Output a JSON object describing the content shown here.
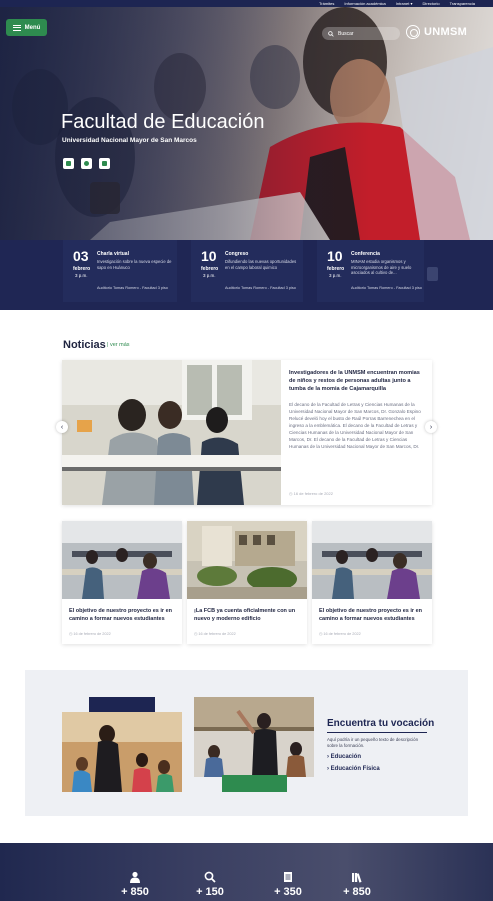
{
  "topbar": {
    "links": [
      "Trámites",
      "Información académica",
      "Intranet ▾",
      "Directorio",
      "Transparencia"
    ]
  },
  "header": {
    "menu_label": "Menú",
    "search_placeholder": "Buscar",
    "logo_text": "UNMSM"
  },
  "hero": {
    "title": "Facultad de Educación",
    "subtitle": "Universidad Nacional Mayor de San Marcos",
    "socials": [
      "facebook-icon",
      "instagram-icon",
      "youtube-icon"
    ]
  },
  "events": [
    {
      "day": "03",
      "month": "febrero",
      "hour": "3 p.m.",
      "title": "Charla virtual",
      "description": "Investigación sobre la nueva especie de sapo en Huánuco",
      "place": "Auditorio Tomas Romero - Facultad 3 piso"
    },
    {
      "day": "10",
      "month": "febrero",
      "hour": "3 p.m.",
      "title": "Congreso",
      "description": "Difundiendo las nuevas oportunidades en el campo laboral quimico",
      "place": "Auditorio Tomas Romero - Facultad 3 piso"
    },
    {
      "day": "10",
      "month": "febrero",
      "hour": "3 p.m.",
      "title": "Conferencia",
      "description": "MINAM estudia organismos y microorganismos de aire y suelo asociados al cultivo de...",
      "place": "Auditorio Tomas Romero - Facultad 3 piso"
    }
  ],
  "news": {
    "title": "Noticias",
    "more_link": "| ver más",
    "featured": {
      "headline": "Investigadores de la UNMSM encuentran momias de niños y restos de personas adultas junto a tumba de la momia de Cajamarquilla",
      "body": "El decano de la Facultad de Letras y Ciencias Humanas de la Universidad Nacional Mayor de San Marcos, Dr. Gonzalo Espino Relucé develó hoy el busto de Raúl Porras Barrenechea en el ingreso a la emblemática. El decano de la Facultad de Letras y Ciencias Humanas de la Universidad Nacional Mayor de San Marcos, Dr. El decano de la Facultad de Letras y Ciencias Humanas de la Universidad Nacional Mayor de San Marcos, Dr.",
      "date": "16 de febrero de 2022"
    },
    "cards": [
      {
        "title": "El objetivo de nuestro proyecto es ir en camino a formar nuevos estudiantes",
        "date": "16 de febrero de 2022"
      },
      {
        "title": "¡La FCB ya cuenta oficialmente con un nuevo y moderno edificio",
        "date": "16 de febrero de 2022"
      },
      {
        "title": "El objetivo de nuestro proyecto es ir en camino a formar nuevos estudiantes",
        "date": "16 de febrero de 2022"
      }
    ]
  },
  "vocation": {
    "title": "Encuentra tu vocación",
    "description": "Aquí podría ir un pequeño texto de descripción sobre la formación.",
    "options": [
      "› Educación",
      "› Educación Física"
    ]
  },
  "stats": [
    {
      "icon": "user-icon",
      "value": "+ 850"
    },
    {
      "icon": "search-icon",
      "value": "+ 150"
    },
    {
      "icon": "document-icon",
      "value": "+ 350"
    },
    {
      "icon": "library-icon",
      "value": "+ 850"
    }
  ],
  "colors": {
    "navy": "#1d2552",
    "green": "#2e8b4f"
  }
}
